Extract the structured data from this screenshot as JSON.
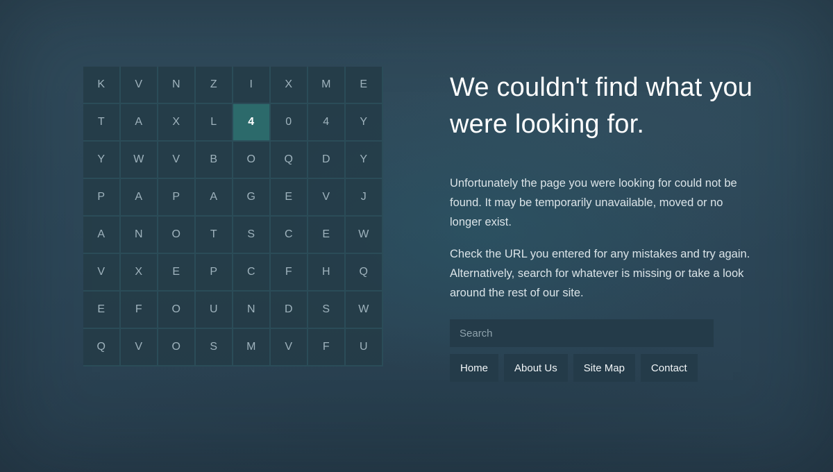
{
  "letter_grid": {
    "rows": [
      [
        "K",
        "V",
        "N",
        "Z",
        "I",
        "X",
        "M",
        "E"
      ],
      [
        "T",
        "A",
        "X",
        "L",
        "4",
        "0",
        "4",
        "Y"
      ],
      [
        "Y",
        "W",
        "V",
        "B",
        "O",
        "Q",
        "D",
        "Y"
      ],
      [
        "P",
        "A",
        "P",
        "A",
        "G",
        "E",
        "V",
        "J"
      ],
      [
        "A",
        "N",
        "O",
        "T",
        "S",
        "C",
        "E",
        "W"
      ],
      [
        "V",
        "X",
        "E",
        "P",
        "C",
        "F",
        "H",
        "Q"
      ],
      [
        "E",
        "F",
        "O",
        "U",
        "N",
        "D",
        "S",
        "W"
      ],
      [
        "Q",
        "V",
        "O",
        "S",
        "M",
        "V",
        "F",
        "U"
      ]
    ],
    "highlighted_cell": {
      "row": 1,
      "col": 4
    }
  },
  "main": {
    "title": "We couldn't find what you were looking for.",
    "paragraph_1": "Unfortunately the page you were looking for could not be found. It may be temporarily unavailable, moved or no longer exist.",
    "paragraph_2": "Check the URL you entered for any mistakes and try again. Alternatively, search for whatever is missing or take a look around the rest of our site."
  },
  "search": {
    "placeholder": "Search",
    "value": ""
  },
  "nav": {
    "home": "Home",
    "about": "About Us",
    "sitemap": "Site Map",
    "contact": "Contact"
  },
  "colors": {
    "background": "#2e4656",
    "highlight": "#2c6a6b",
    "button_bg": "#243b49",
    "text_primary": "#ffffff"
  }
}
